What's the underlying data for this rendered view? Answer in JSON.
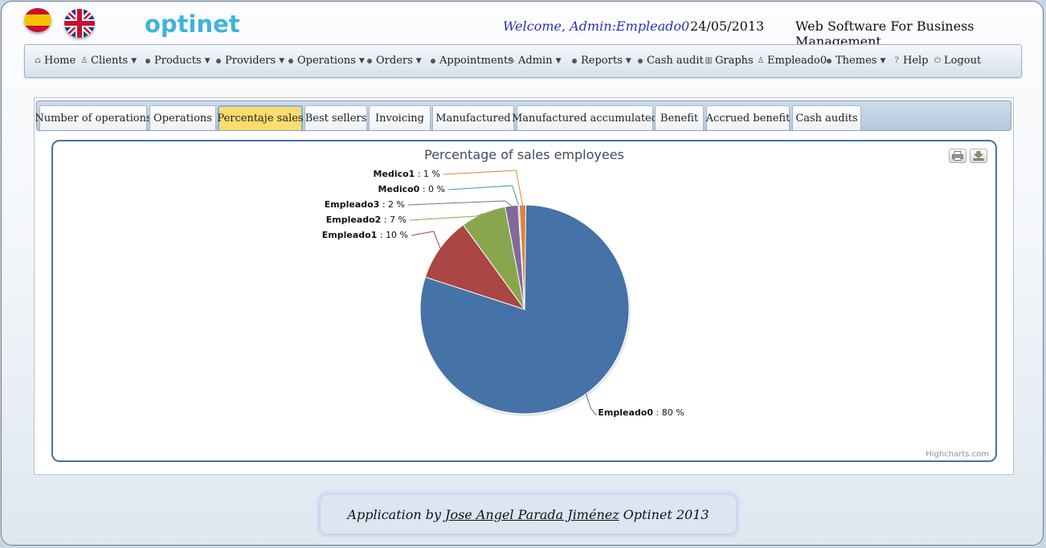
{
  "header": {
    "logo": "optinet",
    "welcome": "Welcome, Admin:Empleado0",
    "date": "24/05/2013",
    "tagline": "Web Software For Business Management."
  },
  "menu": [
    {
      "label": "Home",
      "icon": "home-icon",
      "dropdown": false
    },
    {
      "label": "Clients",
      "icon": "user-icon",
      "dropdown": true
    },
    {
      "label": "Products",
      "icon": "bullet-icon",
      "dropdown": true
    },
    {
      "label": "Providers",
      "icon": "bullet-icon",
      "dropdown": true
    },
    {
      "label": "Operations",
      "icon": "bullet-icon",
      "dropdown": true
    },
    {
      "label": "Orders",
      "icon": "bullet-icon",
      "dropdown": true
    },
    {
      "label": "Appointments",
      "icon": "bullet-icon",
      "dropdown": false
    },
    {
      "label": "Admin",
      "icon": "wrench-icon",
      "dropdown": true
    },
    {
      "label": "Reports",
      "icon": "bullet-icon",
      "dropdown": true
    },
    {
      "label": "Cash audit",
      "icon": "bullet-icon",
      "dropdown": false
    },
    {
      "label": "Graphs",
      "icon": "chart-icon",
      "dropdown": false
    },
    {
      "label": "Empleado0",
      "icon": "user-icon",
      "dropdown": false
    },
    {
      "label": "Themes",
      "icon": "bullet-icon",
      "dropdown": true
    },
    {
      "label": "Help",
      "icon": "question-icon",
      "dropdown": false
    },
    {
      "label": "Logout",
      "icon": "power-icon",
      "dropdown": false
    }
  ],
  "tabs": [
    {
      "label": "Number of operations",
      "active": false
    },
    {
      "label": "Operations",
      "active": false
    },
    {
      "label": "Percentaje sales",
      "active": true
    },
    {
      "label": "Best sellers",
      "active": false
    },
    {
      "label": "Invoicing",
      "active": false
    },
    {
      "label": "Manufactured",
      "active": false
    },
    {
      "label": "Manufactured accumulated",
      "active": false
    },
    {
      "label": "Benefit",
      "active": false
    },
    {
      "label": "Accrued benefit",
      "active": false
    },
    {
      "label": "Cash audits",
      "active": false
    }
  ],
  "chart_data": {
    "type": "pie",
    "title": "Percentage of sales employees",
    "credit": "Highcharts.com",
    "value_suffix": " %",
    "slices": [
      {
        "name": "Empleado0",
        "value": 80,
        "color": "#4572A7"
      },
      {
        "name": "Empleado1",
        "value": 10,
        "color": "#AA4643"
      },
      {
        "name": "Empleado2",
        "value": 7,
        "color": "#89A54E"
      },
      {
        "name": "Empleado3",
        "value": 2,
        "color": "#80699B"
      },
      {
        "name": "Medico0",
        "value": 0,
        "color": "#3D96AE"
      },
      {
        "name": "Medico1",
        "value": 1,
        "color": "#DB843D"
      }
    ]
  },
  "footer": {
    "prefix": "Application by",
    "author": "Jose Angel Parada Jiménez",
    "suffix": "Optinet 2013"
  }
}
